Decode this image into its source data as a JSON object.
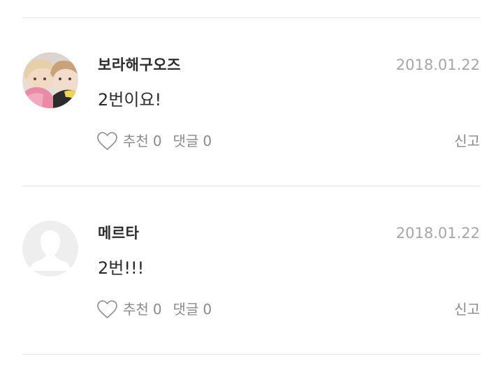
{
  "comments": [
    {
      "author": "보라해구오즈",
      "date": "2018.01.22",
      "text": "2번이요!",
      "avatar": "photo-avatar",
      "like_label": "추천",
      "like_count": "0",
      "reply_label": "댓글",
      "reply_count": "0",
      "report_label": "신고"
    },
    {
      "author": "메르타",
      "date": "2018.01.22",
      "text": "2번!!!",
      "avatar": "default-avatar",
      "like_label": "추천",
      "like_count": "0",
      "reply_label": "댓글",
      "reply_count": "0",
      "report_label": "신고"
    }
  ],
  "colors": {
    "divider": "#e4e4e4",
    "author_text": "#2b2b2b",
    "meta_text": "#a6a6a6",
    "action_text": "#8a8a8a",
    "default_avatar": "#eeeeee"
  },
  "icons": {
    "like": "heart-outline-icon",
    "default_avatar": "user-silhouette-icon"
  }
}
